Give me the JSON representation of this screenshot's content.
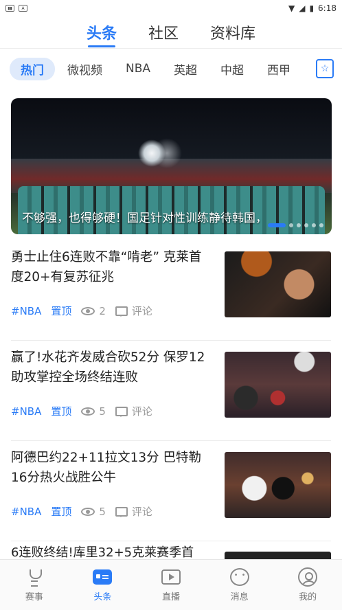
{
  "status_bar": {
    "time": "6:18",
    "left_icons": [
      "sim-icon",
      "a-icon"
    ],
    "right_icons": [
      "wifi-icon",
      "signal-icon",
      "battery-icon"
    ]
  },
  "top_tabs": [
    {
      "label": "头条",
      "active": true
    },
    {
      "label": "社区",
      "active": false
    },
    {
      "label": "资料库",
      "active": false
    }
  ],
  "categories": [
    {
      "label": "热门",
      "active": true
    },
    {
      "label": "微视频",
      "active": false
    },
    {
      "label": "NBA",
      "active": false
    },
    {
      "label": "英超",
      "active": false
    },
    {
      "label": "中超",
      "active": false
    },
    {
      "label": "西甲",
      "active": false
    }
  ],
  "banner": {
    "caption": "不够强，也得够硬！国足针对性训练静待韩国，",
    "slide_count": 6,
    "active_slide": 1
  },
  "news": [
    {
      "title": "勇士止住6连败不靠“啃老” 克莱首度20+有复苏征兆",
      "tag": "#NBA",
      "pinned": "置顶",
      "views": "2",
      "comment_label": "评论"
    },
    {
      "title": "赢了!水花齐发威合砍52分 保罗12助攻掌控全场终结连败",
      "tag": "#NBA",
      "pinned": "置顶",
      "views": "5",
      "comment_label": "评论"
    },
    {
      "title": "阿德巴约22+11拉文13分 巴特勒16分热火战胜公牛",
      "tag": "#NBA",
      "pinned": "置顶",
      "views": "5",
      "comment_label": "评论"
    }
  ],
  "partial_news_title": "6连败终结!库里32+5克莱赛季首",
  "bottom_nav": [
    {
      "label": "赛事",
      "icon": "trophy-icon",
      "active": false
    },
    {
      "label": "头条",
      "icon": "news-icon",
      "active": true
    },
    {
      "label": "直播",
      "icon": "live-play-icon",
      "active": false
    },
    {
      "label": "消息",
      "icon": "message-icon",
      "active": false
    },
    {
      "label": "我的",
      "icon": "profile-icon",
      "active": false
    }
  ],
  "colors": {
    "accent": "#2a7bf6",
    "pill_bg": "#dfeafb",
    "muted": "#999999"
  }
}
